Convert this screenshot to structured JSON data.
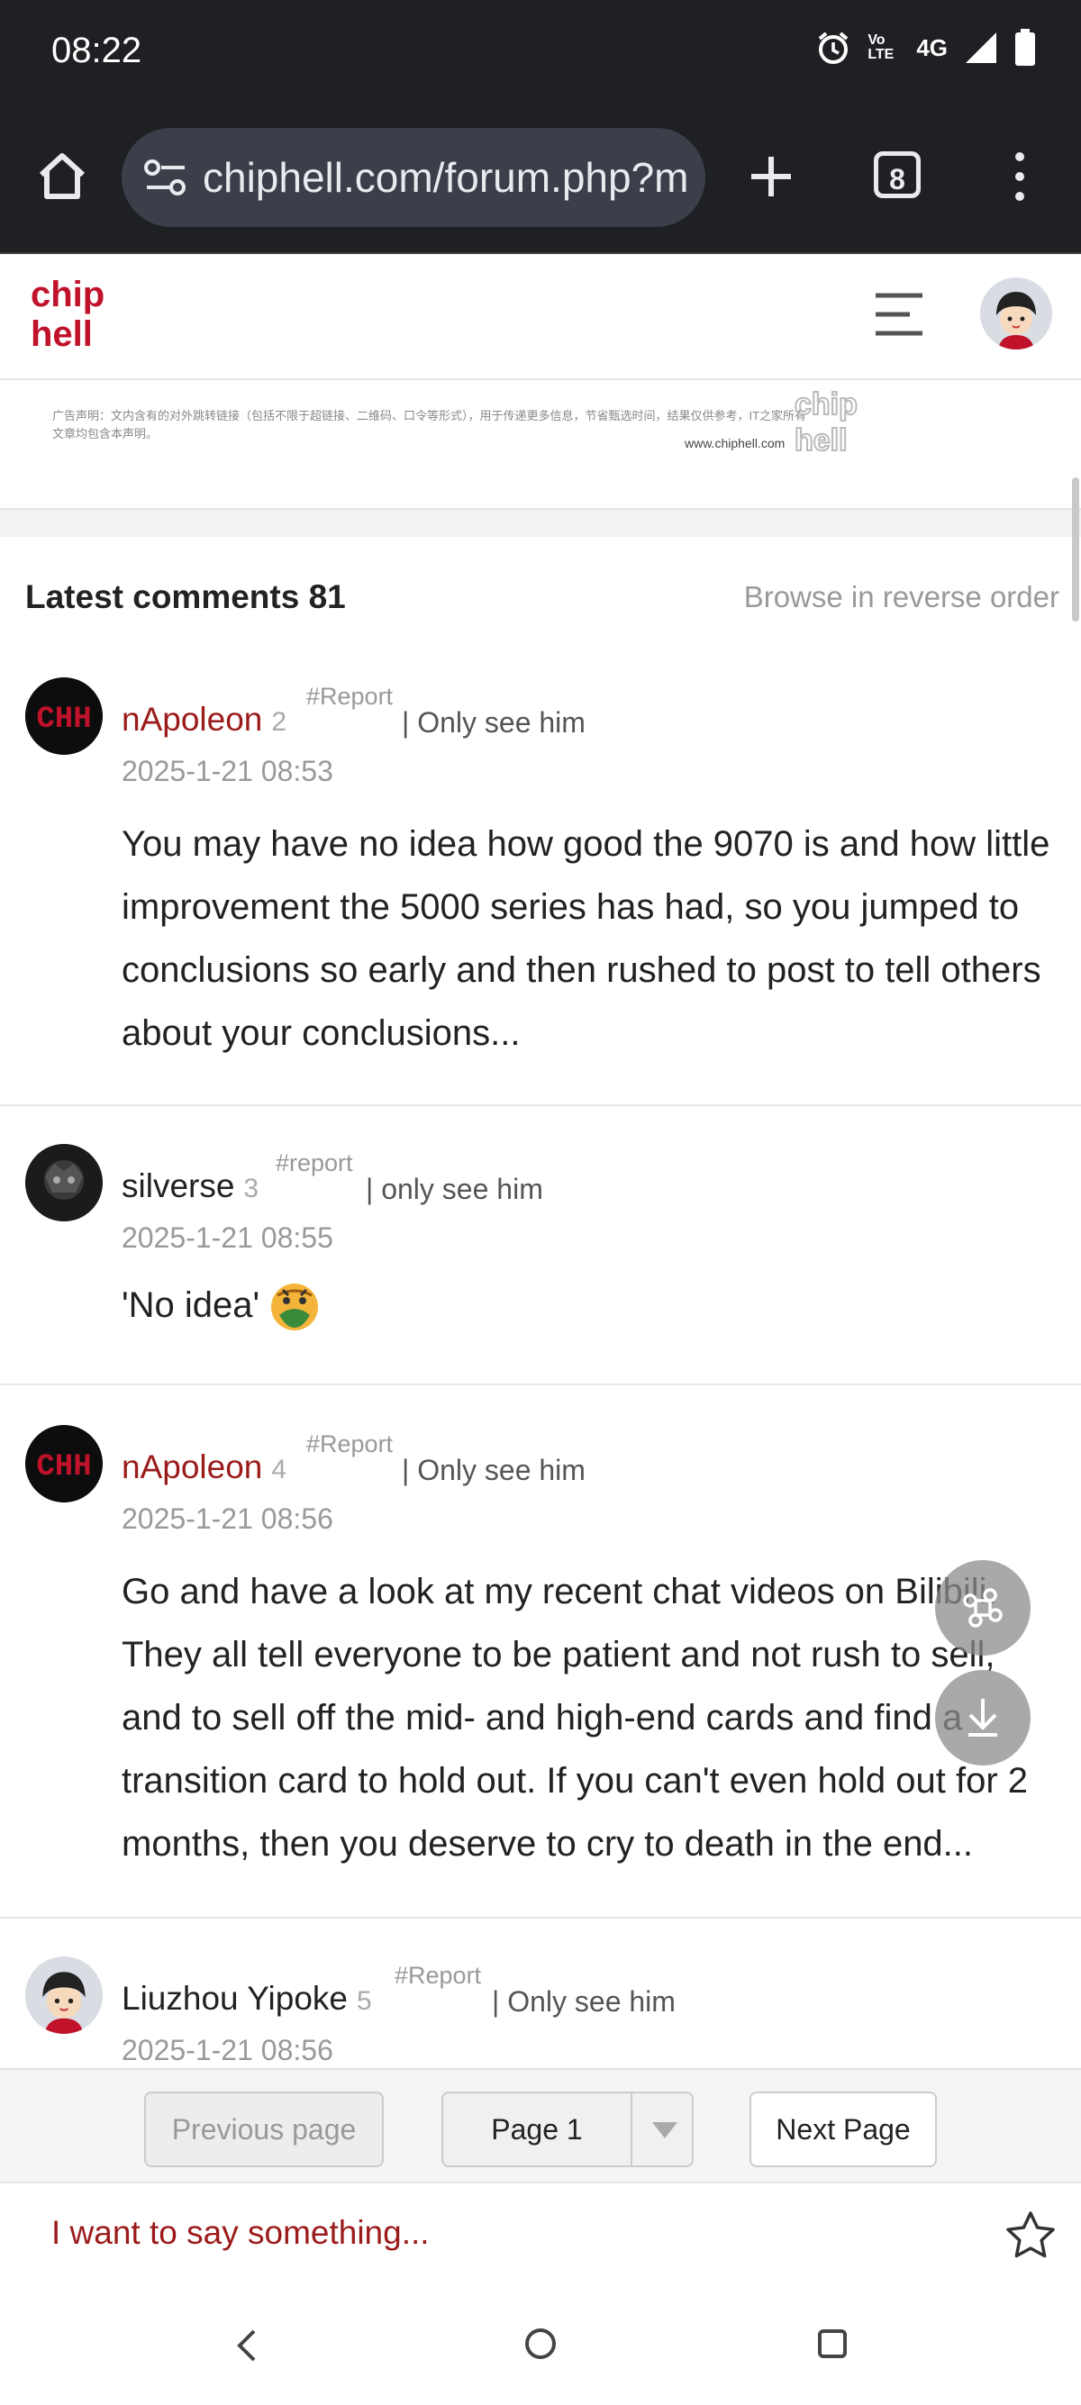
{
  "status_bar": {
    "time": "08:22",
    "network": "4G",
    "volte": "Vo LTE"
  },
  "browser": {
    "url": "chiphell.com/forum.php?mod",
    "tab_count": "8"
  },
  "site": {
    "logo_text": "chip hell"
  },
  "disclaimer": {
    "text": "广告声明：文内含有的对外跳转链接（包括不限于超链接、二维码、口令等形式），用于传递更多信息，节省甄选时间，结果仅供参考，IT之家所有文章均包含本声明。",
    "watermark": "www.chiphell.com"
  },
  "comments_header": {
    "title": "Latest comments 81",
    "reverse_link": "Browse in reverse order"
  },
  "comments": [
    {
      "name": "nApoleon",
      "floor": "2",
      "report": "#Report",
      "only": "| Only see him",
      "date": "2025-1-21 08:53",
      "body": "You may have no idea how good the 9070 is and how little improvement the 5000 series has had, so you jumped to conclusions so early and then rushed to post to tell others about your conclusions...",
      "name_color": "#9b1b1b"
    },
    {
      "name": "silverse",
      "floor": "3",
      "report": "#report",
      "only": "| only see him",
      "date": "2025-1-21 08:55",
      "body": "'No idea'",
      "name_color": "#222222"
    },
    {
      "name": "nApoleon",
      "floor": "4",
      "report": "#Report",
      "only": "| Only see him",
      "date": "2025-1-21 08:56",
      "body": "Go and have a look at my recent chat videos on Bilibili. They all tell everyone to be patient and not rush to sell, and to sell off the mid- and high-end cards and find a transition card to hold out. If you can't even hold out for 2 months, then you deserve to cry to death in the end...",
      "name_color": "#9b1b1b"
    },
    {
      "name": "Liuzhou Yipoke",
      "floor": "5",
      "report": "#Report",
      "only": "| Only see him",
      "date": "2025-1-21 08:56",
      "name_color": "#222222"
    }
  ],
  "pager": {
    "prev": "Previous page",
    "page": "Page 1",
    "next": "Next Page"
  },
  "composer": {
    "placeholder": "I want to say something..."
  },
  "colors": {
    "brand_red": "#c0122a",
    "chrome_bg": "#1f2024",
    "link_red": "#9b1b1b"
  }
}
